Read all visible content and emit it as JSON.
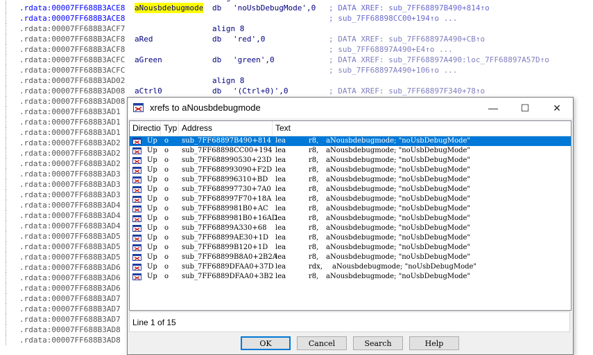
{
  "listing": [
    {
      "addr": ".rdata:00007FF688B3ACE3",
      "label": "",
      "ins": "align 8",
      "op": "",
      "xref": "",
      "current": false
    },
    {
      "addr": ".rdata:00007FF688B3ACE8",
      "label": "aNousbdebugmode",
      "ins": "db",
      "op": "'noUsbDebugMode',0",
      "xref": "; DATA XREF: sub_7FF68897B490+814↑o",
      "current": true
    },
    {
      "addr": ".rdata:00007FF688B3ACE8",
      "label": "",
      "ins": "",
      "op": "",
      "xref": "; sub_7FF68898CC00+194↑o ...",
      "current": true
    },
    {
      "addr": ".rdata:00007FF688B3ACF7",
      "label": "",
      "ins": "align 8",
      "op": "",
      "xref": "",
      "current": false
    },
    {
      "addr": ".rdata:00007FF688B3ACF8",
      "label": "aRed",
      "ins": "db",
      "op": "'red',0",
      "xref": "; DATA XREF: sub_7FF68897A490+CB↑o",
      "current": false
    },
    {
      "addr": ".rdata:00007FF688B3ACF8",
      "label": "",
      "ins": "",
      "op": "",
      "xref": "; sub_7FF68897A490+E4↑o ...",
      "current": false
    },
    {
      "addr": ".rdata:00007FF688B3ACFC",
      "label": "aGreen",
      "ins": "db",
      "op": "'green',0",
      "xref": "; DATA XREF: sub_7FF68897A490:loc_7FF68897A57D↑o",
      "current": false
    },
    {
      "addr": ".rdata:00007FF688B3ACFC",
      "label": "",
      "ins": "",
      "op": "",
      "xref": "; sub_7FF68897A490+106↑o ...",
      "current": false
    },
    {
      "addr": ".rdata:00007FF688B3AD02",
      "label": "",
      "ins": "align 8",
      "op": "",
      "xref": "",
      "current": false
    },
    {
      "addr": ".rdata:00007FF688B3AD08",
      "label": "aCtrl0",
      "ins": "db",
      "op": "'(Ctrl+0)',0",
      "xref": "; DATA XREF: sub_7FF68897F340+78↑o",
      "current": false
    },
    {
      "addr": ".rdata:00007FF688B3AD08",
      "label": "",
      "ins": "",
      "op": "",
      "xref": "",
      "current": false
    },
    {
      "addr": ".rdata:00007FF688B3AD1",
      "label": "",
      "ins": "",
      "op": "",
      "xref": "",
      "current": false
    },
    {
      "addr": ".rdata:00007FF688B3AD1",
      "label": "",
      "ins": "",
      "op": "",
      "xref": "",
      "current": false
    },
    {
      "addr": ".rdata:00007FF688B3AD1",
      "label": "",
      "ins": "",
      "op": "",
      "xref": "",
      "current": false
    },
    {
      "addr": ".rdata:00007FF688B3AD2",
      "label": "",
      "ins": "",
      "op": "",
      "xref": "",
      "current": false
    },
    {
      "addr": ".rdata:00007FF688B3AD2",
      "label": "",
      "ins": "",
      "op": "",
      "xref": "",
      "current": false
    },
    {
      "addr": ".rdata:00007FF688B3AD2",
      "label": "",
      "ins": "",
      "op": "",
      "xref": "",
      "current": false
    },
    {
      "addr": ".rdata:00007FF688B3AD3",
      "label": "",
      "ins": "",
      "op": "",
      "xref": "",
      "current": false
    },
    {
      "addr": ".rdata:00007FF688B3AD3",
      "label": "",
      "ins": "",
      "op": "",
      "xref": "",
      "current": false
    },
    {
      "addr": ".rdata:00007FF688B3AD3",
      "label": "",
      "ins": "",
      "op": "",
      "xref": "",
      "current": false
    },
    {
      "addr": ".rdata:00007FF688B3AD4",
      "label": "",
      "ins": "",
      "op": "",
      "xref": "",
      "current": false
    },
    {
      "addr": ".rdata:00007FF688B3AD4",
      "label": "",
      "ins": "",
      "op": "",
      "xref": "",
      "current": false
    },
    {
      "addr": ".rdata:00007FF688B3AD4",
      "label": "",
      "ins": "",
      "op": "",
      "xref": "",
      "current": false
    },
    {
      "addr": ".rdata:00007FF688B3AD5",
      "label": "",
      "ins": "",
      "op": "",
      "xref": "",
      "current": false
    },
    {
      "addr": ".rdata:00007FF688B3AD5",
      "label": "",
      "ins": "",
      "op": "",
      "xref": "",
      "current": false
    },
    {
      "addr": ".rdata:00007FF688B3AD5",
      "label": "",
      "ins": "",
      "op": "",
      "xref": "",
      "current": false
    },
    {
      "addr": ".rdata:00007FF688B3AD6",
      "label": "",
      "ins": "",
      "op": "",
      "xref": "",
      "current": false
    },
    {
      "addr": ".rdata:00007FF688B3AD6",
      "label": "",
      "ins": "",
      "op": "",
      "xref": "",
      "current": false
    },
    {
      "addr": ".rdata:00007FF688B3AD6",
      "label": "",
      "ins": "",
      "op": "",
      "xref": "",
      "current": false
    },
    {
      "addr": ".rdata:00007FF688B3AD7",
      "label": "",
      "ins": "",
      "op": "",
      "xref": "",
      "current": false
    },
    {
      "addr": ".rdata:00007FF688B3AD7",
      "label": "",
      "ins": "",
      "op": "",
      "xref": "",
      "current": false
    },
    {
      "addr": ".rdata:00007FF688B3AD7",
      "label": "",
      "ins": "",
      "op": "",
      "xref": "",
      "current": false
    },
    {
      "addr": ".rdata:00007FF688B3AD8",
      "label": "",
      "ins": "",
      "op": "",
      "xref": "",
      "current": false
    },
    {
      "addr": ".rdata:00007FF688B3AD8",
      "label": "",
      "ins": "",
      "op": "",
      "xref": "",
      "current": false
    }
  ],
  "dialog": {
    "title": "xrefs to aNousbdebugmode",
    "minimize_glyph": "—",
    "maximize_glyph": "☐",
    "close_glyph": "✕",
    "columns": [
      "Directio",
      "Typ",
      "Address",
      "Text"
    ],
    "rows": [
      {
        "dir": "Up",
        "type": "o",
        "address": "sub_7FF68897B490+814",
        "ins": "lea",
        "reg": "r8,",
        "operand": "aNousbdebugmode; \"noUsbDebugMode\""
      },
      {
        "dir": "Up",
        "type": "o",
        "address": "sub_7FF68898CC00+194",
        "ins": "lea",
        "reg": "r8,",
        "operand": "aNousbdebugmode; \"noUsbDebugMode\""
      },
      {
        "dir": "Up",
        "type": "o",
        "address": "sub_7FF688990530+23D",
        "ins": "lea",
        "reg": "r8,",
        "operand": "aNousbdebugmode; \"noUsbDebugMode\""
      },
      {
        "dir": "Up",
        "type": "o",
        "address": "sub_7FF688993090+F2D",
        "ins": "lea",
        "reg": "r8,",
        "operand": "aNousbdebugmode; \"noUsbDebugMode\""
      },
      {
        "dir": "Up",
        "type": "o",
        "address": "sub_7FF688996310+BD",
        "ins": "lea",
        "reg": "r8,",
        "operand": "aNousbdebugmode; \"noUsbDebugMode\""
      },
      {
        "dir": "Up",
        "type": "o",
        "address": "sub_7FF688997730+7A0",
        "ins": "lea",
        "reg": "r8,",
        "operand": "aNousbdebugmode; \"noUsbDebugMode\""
      },
      {
        "dir": "Up",
        "type": "o",
        "address": "sub_7FF688997F70+18A",
        "ins": "lea",
        "reg": "r8,",
        "operand": "aNousbdebugmode; \"noUsbDebugMode\""
      },
      {
        "dir": "Up",
        "type": "o",
        "address": "sub_7FF6889981B0+AC",
        "ins": "lea",
        "reg": "r8,",
        "operand": "aNousbdebugmode; \"noUsbDebugMode\""
      },
      {
        "dir": "Up",
        "type": "o",
        "address": "sub_7FF6889981B0+16AD",
        "ins": "lea",
        "reg": "r8,",
        "operand": "aNousbdebugmode; \"noUsbDebugMode\""
      },
      {
        "dir": "Up",
        "type": "o",
        "address": "sub_7FF68899A330+68",
        "ins": "lea",
        "reg": "r8,",
        "operand": "aNousbdebugmode; \"noUsbDebugMode\""
      },
      {
        "dir": "Up",
        "type": "o",
        "address": "sub_7FF68899AE30+1D",
        "ins": "lea",
        "reg": "r8,",
        "operand": "aNousbdebugmode; \"noUsbDebugMode\""
      },
      {
        "dir": "Up",
        "type": "o",
        "address": "sub_7FF68899B120+1D",
        "ins": "lea",
        "reg": "r8,",
        "operand": "aNousbdebugmode; \"noUsbDebugMode\""
      },
      {
        "dir": "Up",
        "type": "o",
        "address": "sub_7FF68899B8A0+2B2A",
        "ins": "lea",
        "reg": "r8,",
        "operand": "aNousbdebugmode; \"noUsbDebugMode\""
      },
      {
        "dir": "Up",
        "type": "o",
        "address": "sub_7FF6889DFAA0+37D",
        "ins": "lea",
        "reg": "rdx,",
        "operand": "aNousbdebugmode; \"noUsbDebugMode\""
      },
      {
        "dir": "Up",
        "type": "o",
        "address": "sub_7FF6889DFAA0+3B2",
        "ins": "lea",
        "reg": "r8,",
        "operand": "aNousbdebugmode; \"noUsbDebugMode\""
      }
    ],
    "selected_row": 0,
    "status": "Line 1 of 15",
    "buttons": {
      "ok": "OK",
      "cancel": "Cancel",
      "search": "Search",
      "help": "Help"
    }
  },
  "colors": {
    "selection": "#0078d7",
    "label_highlight": "#ffff00"
  }
}
